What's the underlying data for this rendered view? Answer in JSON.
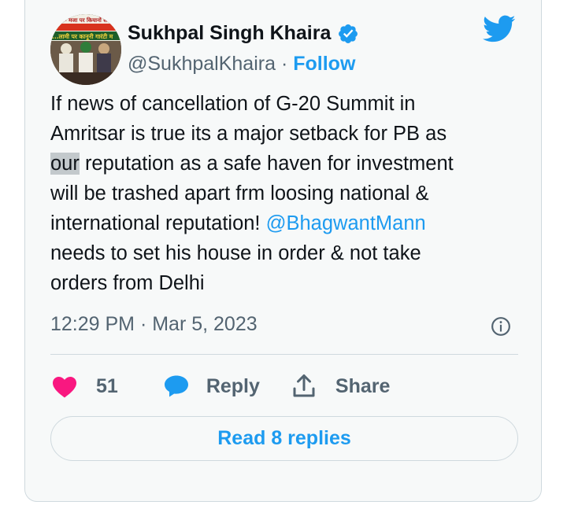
{
  "author": {
    "display_name": "Sukhpal Singh Khaira",
    "handle": "@SukhpalKhaira",
    "separator": "·",
    "follow_label": "Follow",
    "avatar_banner_line1": "...ता- मजा पर कियानों से",
    "avatar_banner_line2": "...लामी पर कानूनी गारंटी म"
  },
  "tweet": {
    "text_before_highlight": "If news of cancellation of G-20 Summit in\nAmritsar is true its a major setback for PB as\n",
    "highlighted_word": "our",
    "text_after_highlight": " reputation as a safe haven for investment\nwill be trashed apart frm loosing national &\ninternational reputation! ",
    "mention": "@BhagwantMann",
    "text_after_mention": "\nneeds to set his house in order & not take\norders from Delhi",
    "timestamp": "12:29 PM · Mar 5, 2023"
  },
  "actions": {
    "like_count": "51",
    "reply_label": "Reply",
    "share_label": "Share"
  },
  "read_replies_label": "Read 8 replies",
  "icons": {
    "verified": "verified-badge-icon",
    "brand": "twitter-bird-icon",
    "info": "info-icon",
    "like": "heart-icon",
    "reply": "speech-bubble-icon",
    "share": "share-upload-icon"
  },
  "colors": {
    "accent": "#1d9bf0",
    "like": "#f91880",
    "text": "#0f1419",
    "secondary": "#536471",
    "card_background": "#f7f9f9"
  }
}
